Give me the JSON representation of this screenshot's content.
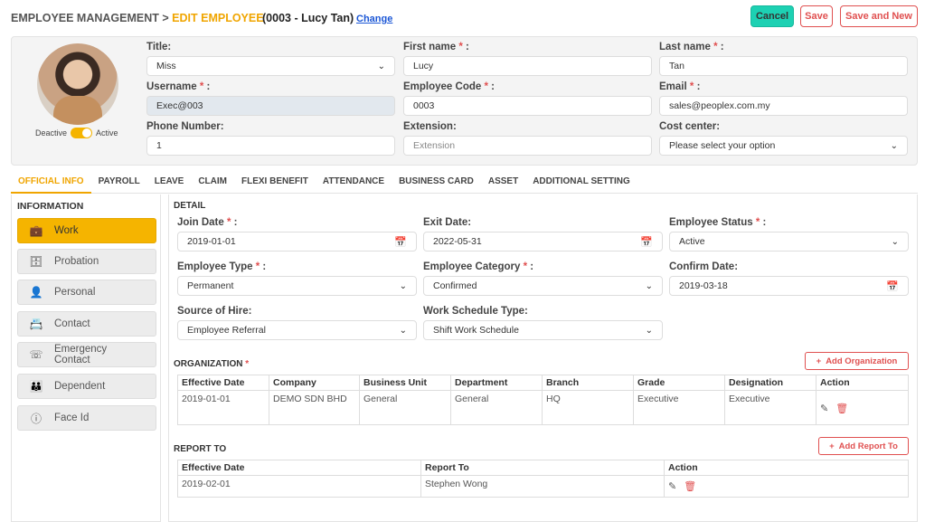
{
  "header": {
    "breadcrumb_root": "EMPLOYEE MANAGEMENT >",
    "breadcrumb_current": "EDIT EMPLOYEE",
    "employee_id": "(0003 - Lucy Tan)",
    "change_link": "Change",
    "cancel_label": "Cancel",
    "save_label": "Save",
    "save_new_label": "Save and New"
  },
  "profile": {
    "toggle_off_label": "Deactive",
    "toggle_on_label": "Active",
    "toggle_state": "Active",
    "fields": {
      "title": {
        "label": "Title:",
        "value": "Miss"
      },
      "first_name": {
        "label": "First name",
        "value": "Lucy"
      },
      "last_name": {
        "label": "Last name",
        "value": "Tan"
      },
      "username": {
        "label": "Username",
        "value": "Exec@003"
      },
      "employee_code": {
        "label": "Employee Code",
        "value": "0003"
      },
      "email": {
        "label": "Email",
        "value": "sales@peoplex.com.my"
      },
      "phone": {
        "label": "Phone Number:",
        "value": "1"
      },
      "extension": {
        "label": "Extension:",
        "placeholder": "Extension"
      },
      "cost_center": {
        "label": "Cost center:",
        "value": "Please select your option"
      }
    }
  },
  "tabs": [
    "OFFICIAL INFO",
    "PAYROLL",
    "LEAVE",
    "CLAIM",
    "FLEXI BENEFIT",
    "ATTENDANCE",
    "BUSINESS CARD",
    "ASSET",
    "ADDITIONAL SETTING"
  ],
  "active_tab": "OFFICIAL INFO",
  "sidebar": {
    "title": "INFORMATION",
    "items": [
      {
        "label": "Work",
        "icon": "briefcase-icon",
        "active": true
      },
      {
        "label": "Probation",
        "icon": "briefcase-icon"
      },
      {
        "label": "Personal",
        "icon": "person-icon"
      },
      {
        "label": "Contact",
        "icon": "contact-card-icon"
      },
      {
        "label": "Emergency Contact",
        "icon": "emergency-phone-icon"
      },
      {
        "label": "Dependent",
        "icon": "group-icon"
      },
      {
        "label": "Face Id",
        "icon": "info-circle-icon"
      }
    ]
  },
  "detail": {
    "title": "DETAIL",
    "join_date": {
      "label": "Join Date",
      "value": "2019-01-01"
    },
    "exit_date": {
      "label": "Exit Date:",
      "value": "2022-05-31"
    },
    "employee_status": {
      "label": "Employee Status",
      "value": "Active"
    },
    "employee_type": {
      "label": "Employee Type",
      "value": "Permanent"
    },
    "employee_category": {
      "label": "Employee Category",
      "value": "Confirmed"
    },
    "confirm_date": {
      "label": "Confirm Date:",
      "value": "2019-03-18"
    },
    "source_of_hire": {
      "label": "Source of Hire:",
      "value": "Employee Referral"
    },
    "work_schedule_type": {
      "label": "Work Schedule Type:",
      "value": "Shift Work Schedule"
    }
  },
  "organization": {
    "title": "ORGANIZATION",
    "add_label": "Add Organization",
    "columns": [
      "Effective Date",
      "Company",
      "Business Unit",
      "Department",
      "Branch",
      "Grade",
      "Designation",
      "Action"
    ],
    "rows": [
      [
        "2019-01-01",
        "DEMO SDN BHD",
        "General",
        "General",
        "HQ",
        "Executive",
        "Executive"
      ]
    ]
  },
  "report_to": {
    "title": "REPORT TO",
    "add_label": "Add Report To",
    "columns": [
      "Effective Date",
      "Report To",
      "Action"
    ],
    "rows": [
      [
        "2019-02-01",
        "Stephen Wong"
      ]
    ]
  },
  "colors": {
    "accent": "#f0a500",
    "toggle": "#f5b400",
    "cancel": "#1dd1b3",
    "danger": "#e05050",
    "link": "#1a56d6"
  }
}
